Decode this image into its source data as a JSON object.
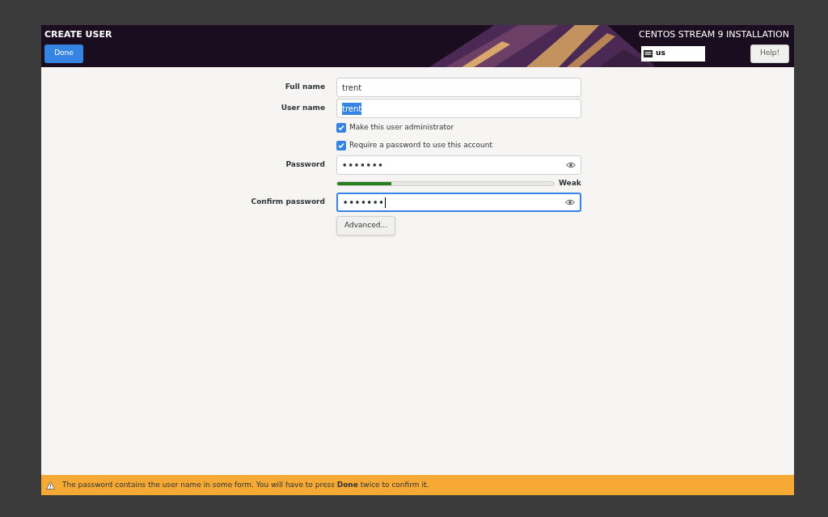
{
  "header": {
    "title": "CREATE USER",
    "done_button": "Done",
    "product": "CENTOS STREAM 9 INSTALLATION",
    "keyboard_layout": "us",
    "help_button": "Help!"
  },
  "form": {
    "fields": [
      {
        "kind": "text",
        "label": "Full name",
        "value": "trent",
        "selected_text": false,
        "focused": false
      },
      {
        "kind": "text",
        "label": "User name",
        "value": "trent",
        "selected_text": true,
        "focused": false
      },
      {
        "kind": "checkbox",
        "label": "Make this user administrator",
        "checked": true
      },
      {
        "kind": "checkbox",
        "label": "Require a password to use this account",
        "checked": true
      },
      {
        "kind": "password",
        "label": "Password",
        "value": "•••••••",
        "selected_text": false,
        "focused": false
      },
      {
        "kind": "meter",
        "level": 0.25,
        "reading": "Weak"
      },
      {
        "kind": "password",
        "label": "Confirm password",
        "value": "•••••••",
        "selected_text": false,
        "focused": true
      },
      {
        "kind": "button",
        "label": "Advanced..."
      }
    ]
  },
  "warning": "The password contains the user name in some form. You will have to press **Done** twice to confirm it."
}
